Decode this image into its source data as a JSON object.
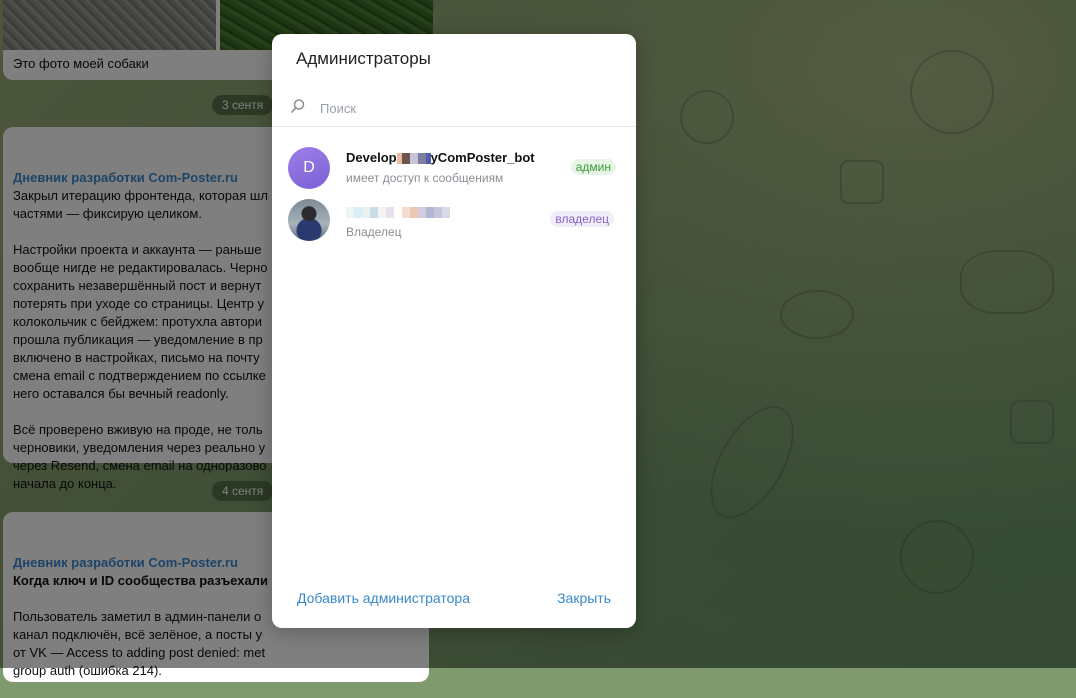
{
  "chat": {
    "photo_caption": "Это фото моей собаки",
    "date_1": "3 сентя",
    "date_2": "4 сентя",
    "msg1": {
      "author": "Дневник разработки Com-Poster.ru",
      "text": "Закрыл итерацию фронтенда, которая шл\nчастями — фиксирую целиком.\n\nНастройки проекта и аккаунта — раньше\nвообще нигде не редактировалась. Черно\nсохранить незавершённый пост и вернут\nпотерять при уходе со страницы. Центр у\nколокольчик с бейджем: протухла автори\nпрошла публикация — уведомление в пр\nвключено в настройках, письмо на почту\nсмена email с подтверждением по ссылке\nнего оставался бы вечный readonly.\n\nВсё проверено вживую на проде, не толь\nчерновики, уведомления через реально у\nчерез Resend, смена email на одноразово\nначала до конца."
    },
    "msg2": {
      "author": "Дневник разработки Com-Poster.ru",
      "headline": "Когда ключ и ID сообщества разъехали",
      "text": "\nПользователь заметил в админ-панели о\nканал подключён, всё зелёное, а посты у\nот VK — Access to adding post denied: met\ngroup auth (ошибка 214)."
    }
  },
  "modal": {
    "title": "Администраторы",
    "search_placeholder": "Поиск",
    "admins": [
      {
        "avatar_letter": "D",
        "name_start": "Develop",
        "name_end": "yComPoster_bot",
        "status": "имеет доступ к сообщениям",
        "role": "админ"
      },
      {
        "avatar_letter": "",
        "name_start": "",
        "name_end": "",
        "status": "Владелец",
        "role": "владелец"
      }
    ],
    "add_button": "Добавить администратора",
    "close_button": "Закрыть"
  },
  "colors": {
    "accent": "#3a88c9",
    "admin_badge": "#3a9a3a",
    "owner_badge": "#8a63c8",
    "avatar_purple": "#8a6fe0"
  }
}
